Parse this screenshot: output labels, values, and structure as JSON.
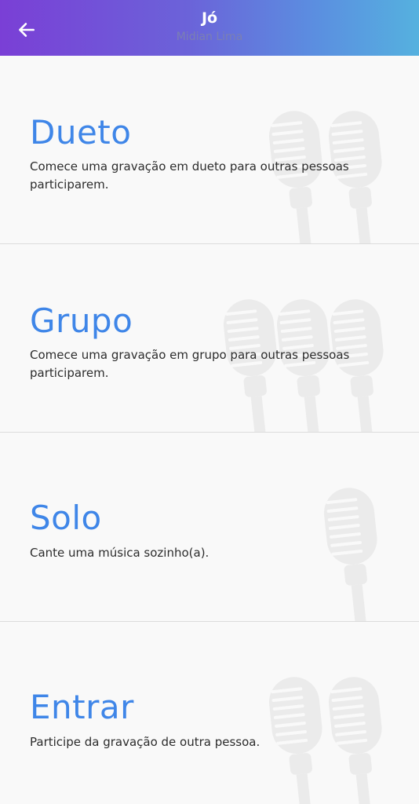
{
  "header": {
    "title": "Jó",
    "subtitle": "Midian Lima",
    "back_icon": "arrow-left-icon",
    "gradient_start": "#7a3fd6",
    "gradient_end": "#55b1df"
  },
  "options": [
    {
      "title": "Dueto",
      "description": "Comece uma gravação em dueto para outras pessoas participarem.",
      "mic_count": 2
    },
    {
      "title": "Grupo",
      "description": "Comece uma gravação em grupo para outras pessoas participarem.",
      "mic_count": 3
    },
    {
      "title": "Solo",
      "description": "Cante uma música sozinho(a).",
      "mic_count": 1
    },
    {
      "title": "Entrar",
      "description": "Participe da gravação de outra pessoa.",
      "mic_count": 2
    }
  ],
  "colors": {
    "accent": "#3f86e8",
    "background": "#f9f9f9",
    "divider": "#dcdcdc",
    "mic_watermark": "#ebebeb"
  }
}
